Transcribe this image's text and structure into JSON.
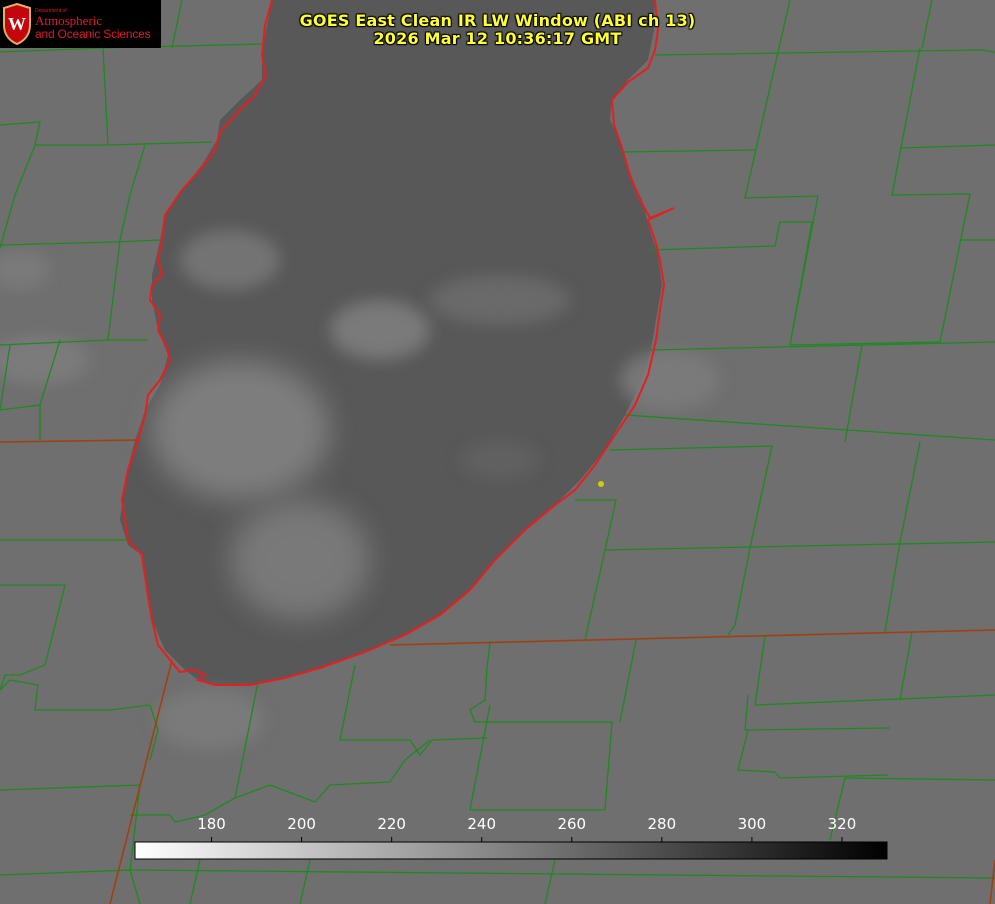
{
  "title": {
    "line1": "GOES East Clean IR LW Window (ABI ch 13)",
    "line2": "2026 Mar 12 10:36:17 GMT"
  },
  "logo": {
    "dept": "Department of",
    "line1": "Atmospheric",
    "line2": "and Oceanic Sciences",
    "seal_letter": "W"
  },
  "colorbar": {
    "ticks": [
      "180",
      "200",
      "220",
      "240",
      "260",
      "280",
      "300",
      "320"
    ],
    "tick_values": [
      180,
      200,
      220,
      240,
      260,
      280,
      300,
      320
    ],
    "range": [
      163,
      330
    ],
    "colormap": "white-to-black"
  },
  "colors": {
    "title": "#ffff33",
    "county_borders": "#1e8a1e",
    "lake_shoreline": "#e81e1e",
    "state_border": "#a04010",
    "marker": "#d6c80a",
    "background": "#6e6e6e"
  }
}
